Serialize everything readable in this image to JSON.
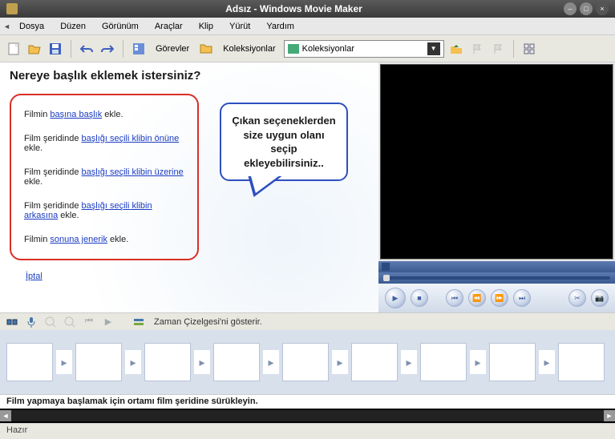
{
  "window": {
    "title": "Adsız - Windows Movie Maker"
  },
  "menu": {
    "file": "Dosya",
    "edit": "Düzen",
    "view": "Görünüm",
    "tools": "Araçlar",
    "clip": "Klip",
    "play": "Yürüt",
    "help": "Yardım"
  },
  "toolbar": {
    "tasks": "Görevler",
    "collections": "Koleksiyonlar",
    "dropdown_value": "Koleksiyonlar"
  },
  "pane": {
    "title": "Nereye başlık eklemek istersiniz?",
    "opt1_pre": "Filmin ",
    "opt1_link": "başına başlık",
    "opt1_post": " ekle.",
    "opt2_pre": "Film şeridinde ",
    "opt2_link": "başlığı seçili klibin önüne",
    "opt2_post": " ekle.",
    "opt3_pre": "Film şeridinde ",
    "opt3_link": "başlığı seçili klibin üzerine",
    "opt3_post": " ekle.",
    "opt4_pre": "Film şeridinde ",
    "opt4_link": "başlığı seçili klibin arkasına",
    "opt4_post": " ekle.",
    "opt5_pre": "Filmin ",
    "opt5_link": "sonuna jenerik",
    "opt5_post": " ekle.",
    "cancel": "İptal"
  },
  "callout": {
    "text": "Çıkan seçeneklerden size uygun olanı seçip ekleyebilirsiniz.."
  },
  "timeline": {
    "toggle": "Zaman Çizelgesi'ni gösterir."
  },
  "hint": "Film yapmaya başlamak için ortamı film şeridine sürükleyin.",
  "status": "Hazır"
}
